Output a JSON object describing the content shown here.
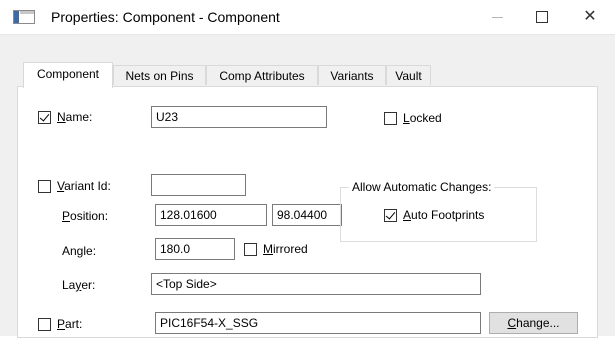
{
  "window": {
    "title": "Properties: Component - Component",
    "icons": {
      "app": "app-window-icon",
      "minimize": "minimize-icon",
      "maximize": "maximize-icon",
      "close": "close-icon"
    },
    "close_glyph": "✕"
  },
  "tabs": [
    {
      "label": "Component",
      "active": true
    },
    {
      "label": "Nets on Pins",
      "active": false
    },
    {
      "label": "Comp Attributes",
      "active": false
    },
    {
      "label": "Variants",
      "active": false
    },
    {
      "label": "Vault",
      "active": false
    }
  ],
  "form": {
    "name": {
      "label_underlined": "N",
      "label_rest": "ame:",
      "checked": true,
      "value": "U23"
    },
    "locked": {
      "label_underlined": "L",
      "label_rest": "ocked",
      "checked": false
    },
    "variant_id": {
      "label_underlined": "V",
      "label_rest": "ariant Id:",
      "checked": false,
      "value": ""
    },
    "position": {
      "label_underlined": "P",
      "label_rest": "osition:",
      "x": "128.01600",
      "y": "98.04400"
    },
    "angle": {
      "label": "Angle:",
      "value": "180.0"
    },
    "mirrored": {
      "label_underlined": "M",
      "label_rest": "irrored",
      "checked": false
    },
    "layer": {
      "label_before": "La",
      "label_underlined": "y",
      "label_after": "er:",
      "value": "<Top Side>"
    },
    "part": {
      "label_underlined": "P",
      "label_rest": "art:",
      "checked": false,
      "value": "PIC16F54-X_SSG"
    },
    "change_button": {
      "label_underlined": "C",
      "label_rest": "hange..."
    }
  },
  "auto_changes": {
    "title": "Allow Automatic Changes:",
    "auto_footprints": {
      "label_underlined": "A",
      "label_rest": "uto Footprints",
      "checked": true
    }
  },
  "colors": {
    "dialog_bg": "#f0f0f0",
    "panel_bg": "#ffffff",
    "border": "#d9d9d9"
  }
}
